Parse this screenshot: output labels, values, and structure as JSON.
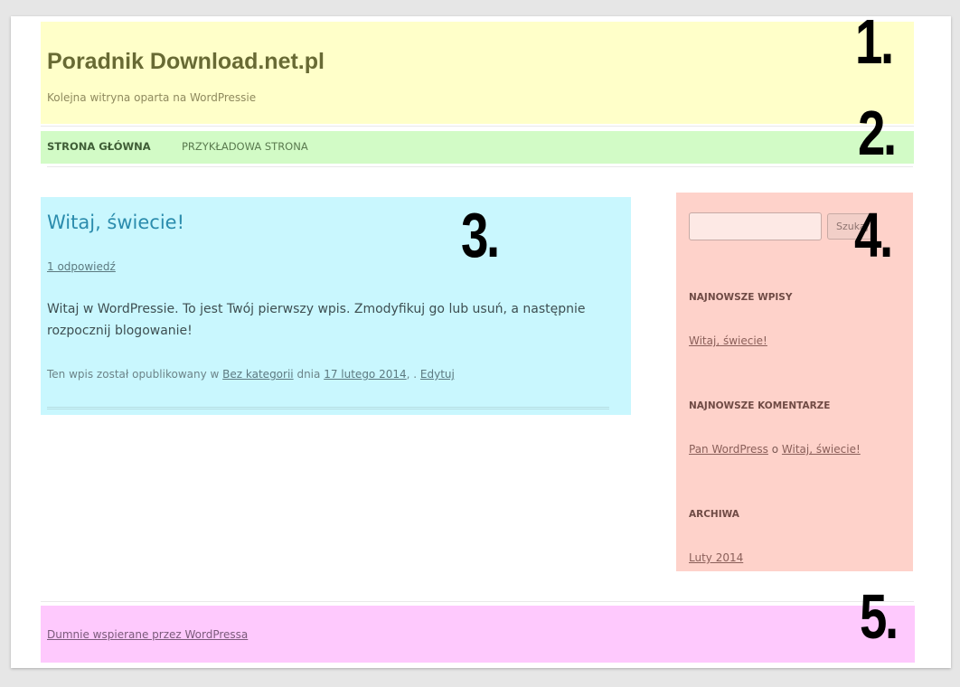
{
  "header": {
    "site_title": "Poradnik Download.net.pl",
    "site_description": "Kolejna witryna oparta na WordPressie"
  },
  "nav": {
    "items": [
      {
        "label": "STRONA GŁÓWNA",
        "active": true
      },
      {
        "label": "PRZYKŁADOWA STRONA",
        "active": false
      }
    ]
  },
  "post": {
    "title": "Witaj, świecie!",
    "comments_link": "1 odpowiedź",
    "content": "Witaj w WordPressie. To jest Twój pierwszy wpis. Zmodyfikuj go lub usuń, a następnie rozpocznij blogowanie!",
    "meta": {
      "prefix": "Ten wpis został opublikowany w",
      "category": "Bez kategorii",
      "date_prefix": "dnia",
      "date": "17 lutego 2014",
      "separator": ", .",
      "edit": "Edytuj"
    }
  },
  "sidebar": {
    "search": {
      "value": "",
      "button_label": "Szukaj"
    },
    "recent_posts": {
      "title": "NAJNOWSZE WPISY",
      "items": [
        "Witaj, świecie!"
      ]
    },
    "recent_comments": {
      "title": "NAJNOWSZE KOMENTARZE",
      "items": [
        {
          "author": "Pan WordPress",
          "connector": "o",
          "post": "Witaj, świecie!"
        }
      ]
    },
    "archives": {
      "title": "ARCHIWA",
      "items": [
        "Luty 2014"
      ]
    }
  },
  "footer": {
    "credit": "Dumnie wspierane przez WordPressa"
  },
  "markers": [
    "1.",
    "2.",
    "3.",
    "4.",
    "5."
  ],
  "colors": {
    "header_region": "#ffffc9",
    "nav_region": "#d2fbc6",
    "content_region": "#c9f7fe",
    "sidebar_region": "#fed2ca",
    "footer_region": "#fec9fd"
  }
}
